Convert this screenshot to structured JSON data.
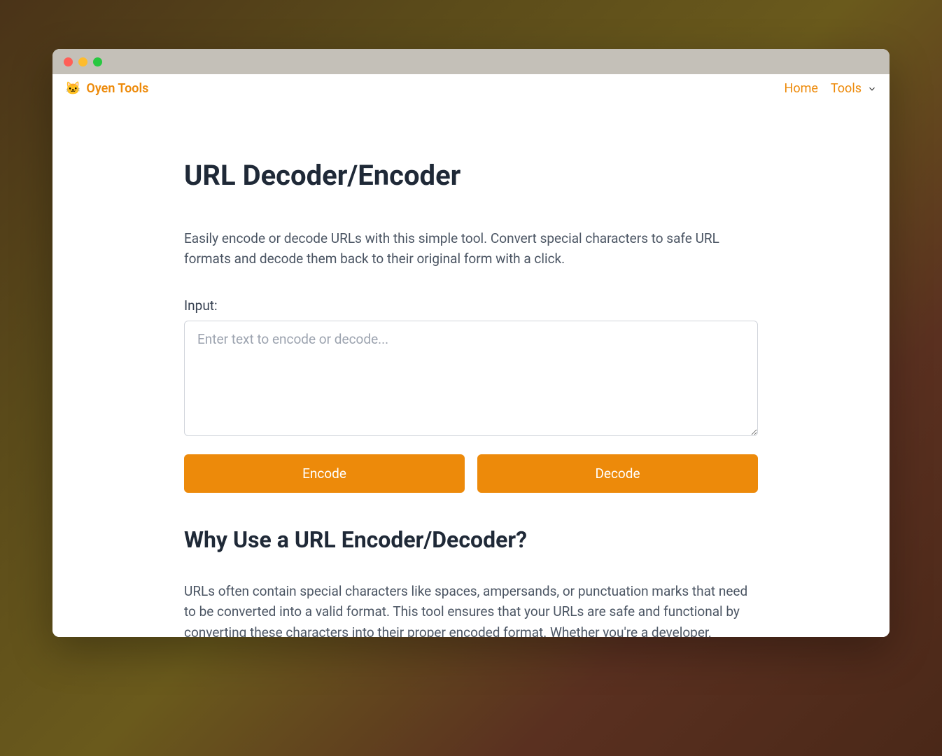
{
  "brand": {
    "icon": "🐱",
    "name": "Oyen Tools"
  },
  "nav": {
    "home": "Home",
    "tools": "Tools"
  },
  "main": {
    "title": "URL Decoder/Encoder",
    "description": "Easily encode or decode URLs with this simple tool. Convert special characters to safe URL formats and decode them back to their original form with a click.",
    "input_label": "Input:",
    "input_placeholder": "Enter text to encode or decode...",
    "encode_button": "Encode",
    "decode_button": "Decode"
  },
  "section": {
    "title": "Why Use a URL Encoder/Decoder?",
    "text": "URLs often contain special characters like spaces, ampersands, or punctuation marks that need to be converted into a valid format. This tool ensures that your URLs are safe and functional by converting these characters into their proper encoded format. Whether you're a developer, marketer, or just"
  },
  "colors": {
    "accent": "#ed8a0a"
  }
}
